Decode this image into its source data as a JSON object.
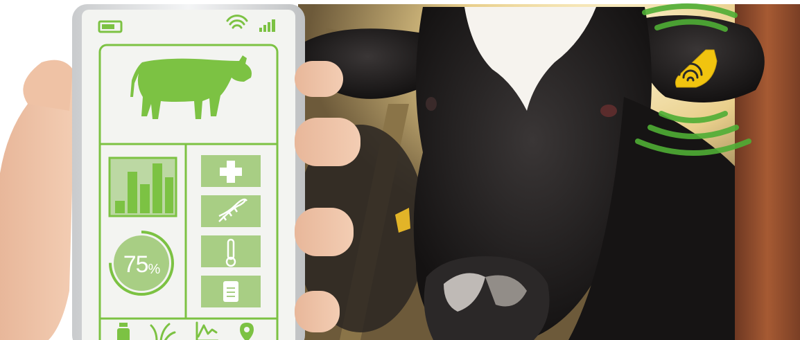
{
  "scene": {
    "subject": "hand-holding-phone-with-cow-monitoring-app",
    "background_subject": "dairy-cow-with-ear-tag",
    "colors": {
      "accent_green": "#7cc243",
      "dark_green": "#3f8f2a",
      "cow_black": "#1c1a1a",
      "tag_yellow": "#f1c40f",
      "rust": "#8e4a2a",
      "sky_glow": "#f6e4a8"
    }
  },
  "phone": {
    "status_icons": [
      "battery-icon",
      "wifi-icon",
      "signal-icon"
    ],
    "hero_icon": "cow-icon",
    "chart_icon": "bar-chart-icon",
    "progress": {
      "value": 75,
      "number_text": "75",
      "unit_text": "%"
    },
    "feature_tiles": [
      "health-cross-icon",
      "dna-icon",
      "thermometer-icon",
      "report-document-icon"
    ],
    "bottom_bar_icons": [
      "milk-bottle-icon",
      "grass-icon",
      "activity-graph-icon",
      "location-pin-icon"
    ]
  },
  "ear_tag_icon": "wifi-icon"
}
